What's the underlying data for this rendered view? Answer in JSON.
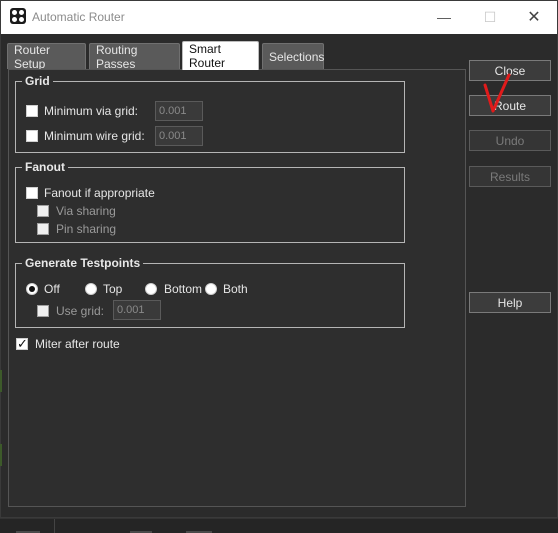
{
  "window": {
    "title": "Automatic Router",
    "controls": {
      "minimize": "—",
      "maximize": "☐",
      "close": "✕"
    }
  },
  "tabs": [
    {
      "label": "Router Setup",
      "active": false
    },
    {
      "label": "Routing Passes",
      "active": false
    },
    {
      "label": "Smart Router",
      "active": true
    },
    {
      "label": "Selections",
      "active": false
    }
  ],
  "grid": {
    "legend": "Grid",
    "min_via_label": "Minimum via grid:",
    "min_via_value": "0.001",
    "min_via_checked": false,
    "min_wire_label": "Minimum wire grid:",
    "min_wire_value": "0.001",
    "min_wire_checked": false
  },
  "fanout": {
    "legend": "Fanout",
    "fanout_label": "Fanout if appropriate",
    "via_sharing_label": "Via sharing",
    "pin_sharing_label": "Pin sharing"
  },
  "testpoints": {
    "legend": "Generate Testpoints",
    "options": [
      "Off",
      "Top",
      "Bottom",
      "Both"
    ],
    "selected": "Off",
    "use_grid_label": "Use grid:",
    "use_grid_value": "0.001"
  },
  "miter": {
    "label": "Miter after route",
    "checked": true
  },
  "buttons": {
    "close": "Close",
    "route": "Route",
    "undo": "Undo",
    "results": "Results",
    "help": "Help"
  },
  "colors": {
    "background": "#2b2b2b",
    "annotation": "#e01b1b",
    "active_tab": "#ffffff"
  },
  "icons": [
    "app-icon",
    "annotation-checkmark"
  ]
}
